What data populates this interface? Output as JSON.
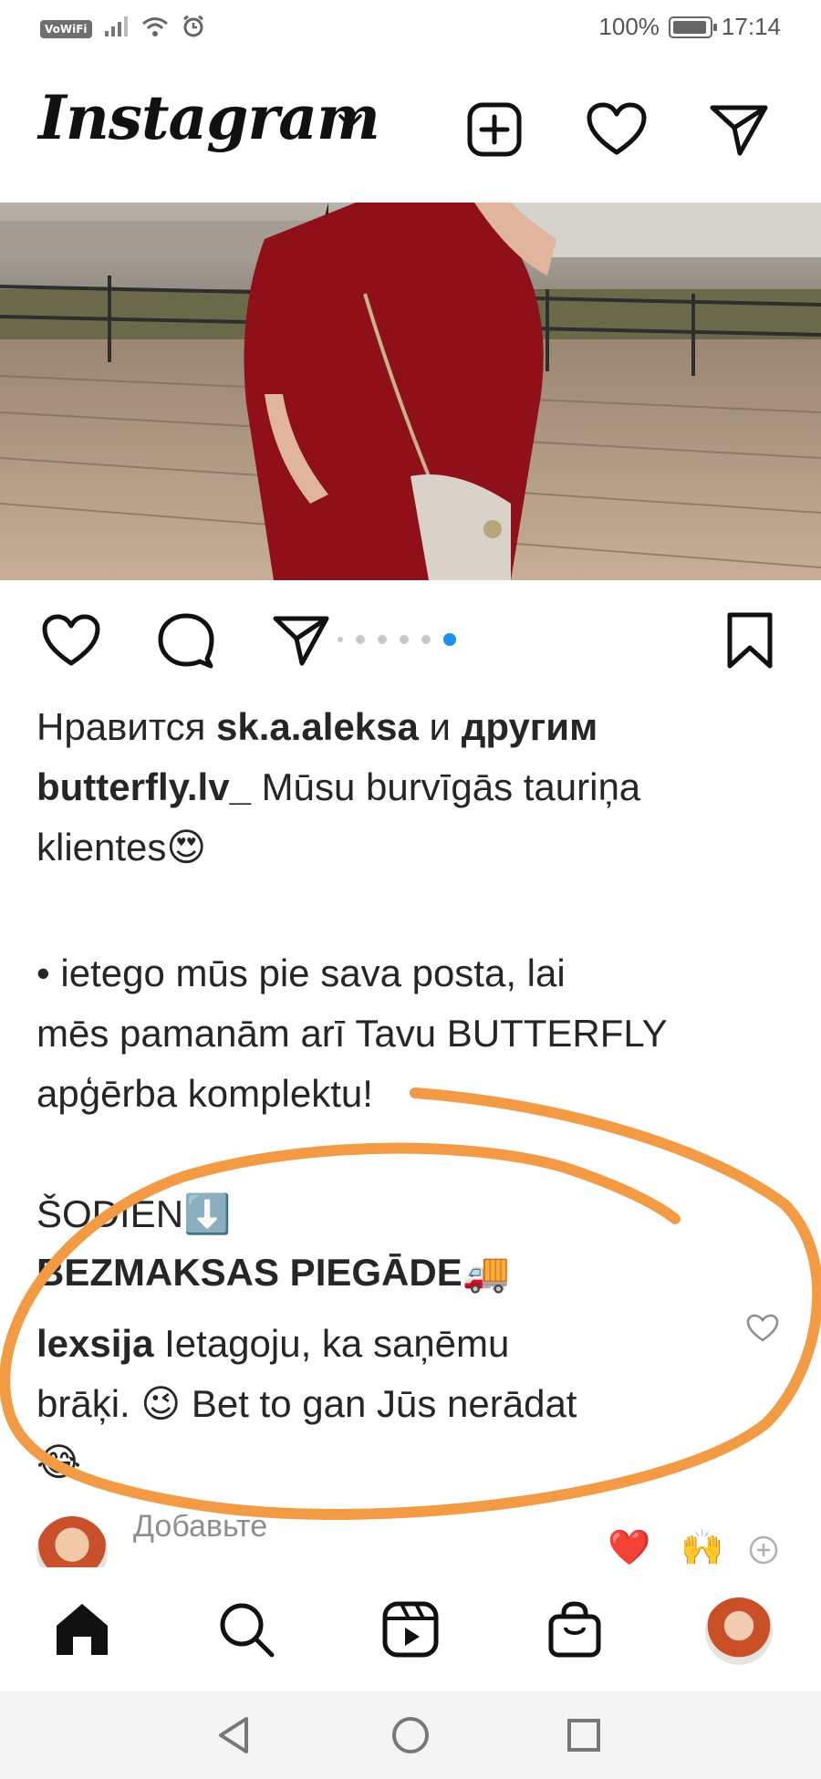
{
  "status_bar": {
    "vowifi": "VoWiFi",
    "battery_percent": "100%",
    "battery_level": 1.0,
    "time": "17:14"
  },
  "header": {
    "logo_text": "Instagram"
  },
  "post": {
    "carousel_total_dots": 6,
    "carousel_active_index": 5,
    "likes": {
      "prefix": "Нравится ",
      "user": "sk.a.aleksa",
      "middle": " и ",
      "others": "другим"
    },
    "caption": {
      "username": "butterfly.lv_",
      "line1": " Mūsu burvīgās tauriņa",
      "line2": "klientes",
      "line2_emoji": "😍",
      "bullet_line1": " • ietego mūs pie sava posta, lai",
      "bullet_line2": "mēs pamanām arī Tavu BUTTERFLY",
      "bullet_line3": "apģērba komplektu!",
      "today": "ŠODIEN",
      "today_emoji": "⬇️",
      "free_delivery": "BEZMAKSAS PIEGĀDE",
      "free_delivery_emoji": "🚚"
    },
    "comment": {
      "username": "lexsija",
      "line1": " Ietagoju, ka saņēmu",
      "line2_a": "brāķi. ",
      "emoji1": "😉",
      "line2_b": " Bet to gan Jūs nerādat",
      "emoji2": "😂"
    },
    "add_comment": {
      "placeholder": "Добавьте"
    },
    "quick_reactions": [
      "❤️",
      "🙌"
    ]
  },
  "colors": {
    "annotation": "#F39A45",
    "carousel_active": "#1E90F0",
    "reaction_heart": "#E0151F"
  }
}
